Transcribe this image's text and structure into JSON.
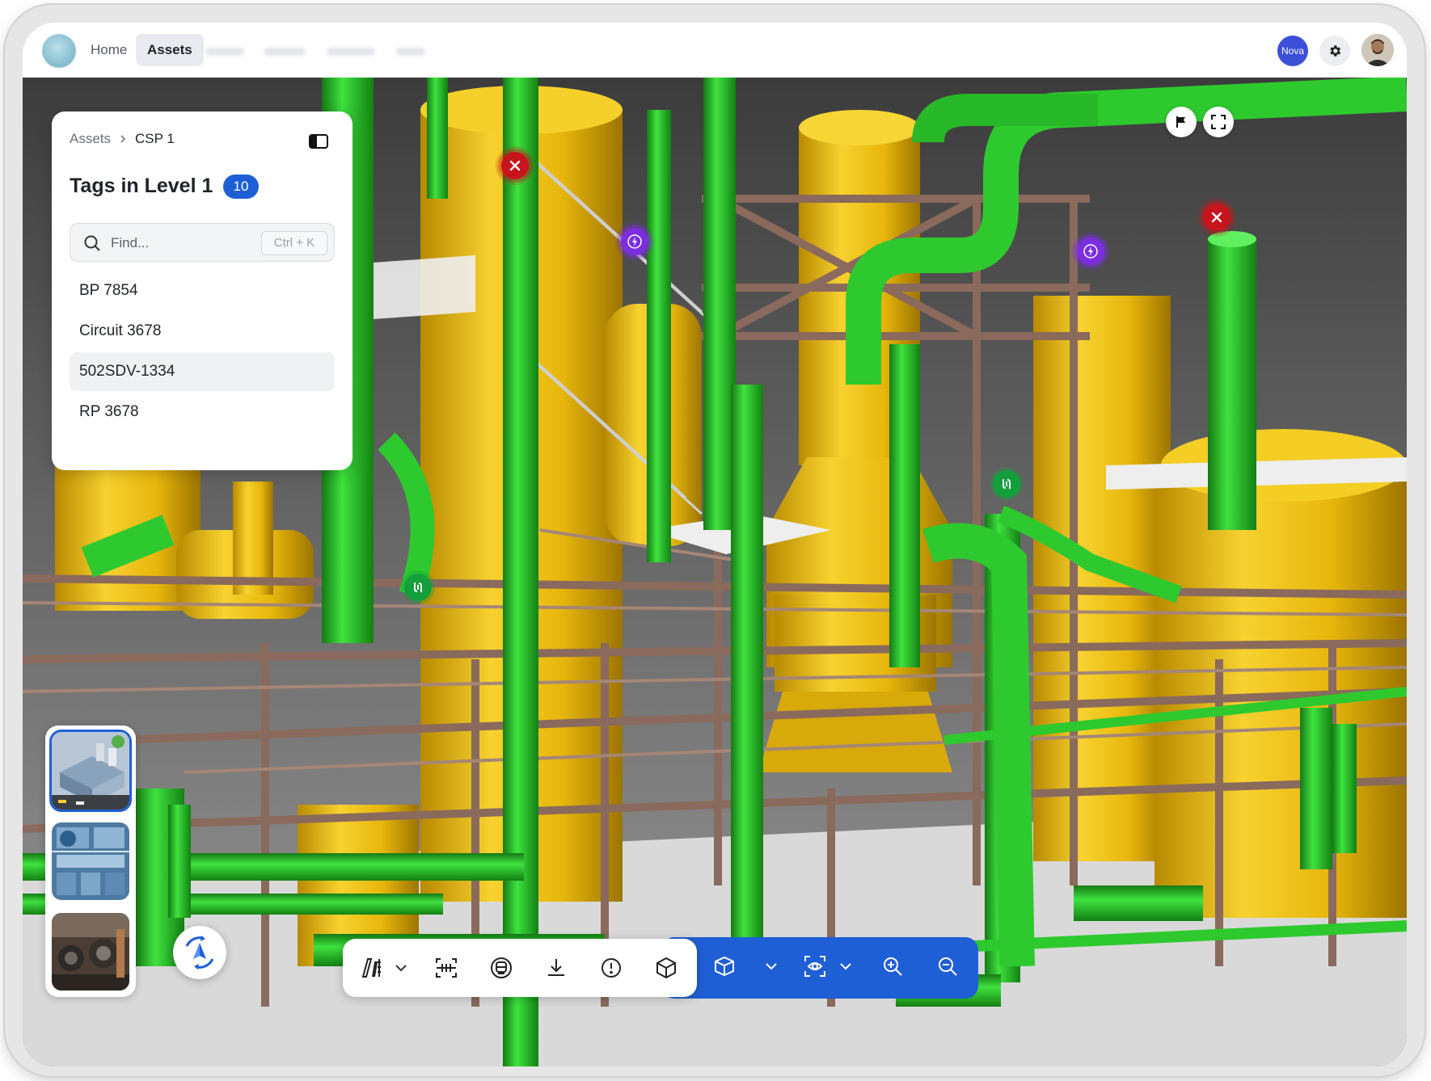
{
  "nav": {
    "items": [
      {
        "label": "Home",
        "active": false
      },
      {
        "label": "Assets",
        "active": true
      }
    ],
    "user_badge": "Nova",
    "settings_icon": "gear-icon",
    "profile_icon": "user-avatar"
  },
  "panel": {
    "breadcrumb": [
      "Assets",
      "CSP 1"
    ],
    "title": "Tags in Level 1",
    "count": "10",
    "search": {
      "placeholder": "Find...",
      "value": "",
      "shortcut": "Ctrl + K"
    },
    "tags": [
      {
        "label": "BP 7854",
        "selected": false
      },
      {
        "label": "Circuit 3678",
        "selected": false
      },
      {
        "label": "502SDV-1334",
        "selected": true
      },
      {
        "label": "RP 3678",
        "selected": false
      }
    ]
  },
  "viewer": {
    "top_right_buttons": [
      "flag-icon",
      "fullscreen-icon"
    ],
    "markers": [
      {
        "type": "maintenance",
        "icon": "tools-icon",
        "color": "#c8141c"
      },
      {
        "type": "maintenance",
        "icon": "tools-icon",
        "color": "#c8141c"
      },
      {
        "type": "electrical",
        "icon": "lightning-icon",
        "color": "#7a2ee0"
      },
      {
        "type": "electrical",
        "icon": "lightning-icon",
        "color": "#7a2ee0"
      },
      {
        "type": "valve",
        "icon": "valve-icon",
        "color": "#13a03c"
      },
      {
        "type": "valve",
        "icon": "valve-icon",
        "color": "#13a03c"
      }
    ],
    "thumbnails": [
      {
        "name": "site-overview",
        "selected": true
      },
      {
        "name": "floor-plan",
        "selected": false
      },
      {
        "name": "machinery-photo",
        "selected": false
      }
    ],
    "toolbar": {
      "left_tools": [
        "measure-icon",
        "section-icon",
        "layers-icon",
        "download-icon",
        "info-icon",
        "cube-icon"
      ],
      "right_tools": [
        "box-view-icon",
        "visibility-icon",
        "zoom-in-icon",
        "zoom-out-icon"
      ]
    }
  },
  "colors": {
    "accent": "#1f5fd6",
    "pipe_green": "#2ec92e",
    "vessel_yellow": "#f0c21a",
    "structure_brown": "#8a6a5c"
  }
}
